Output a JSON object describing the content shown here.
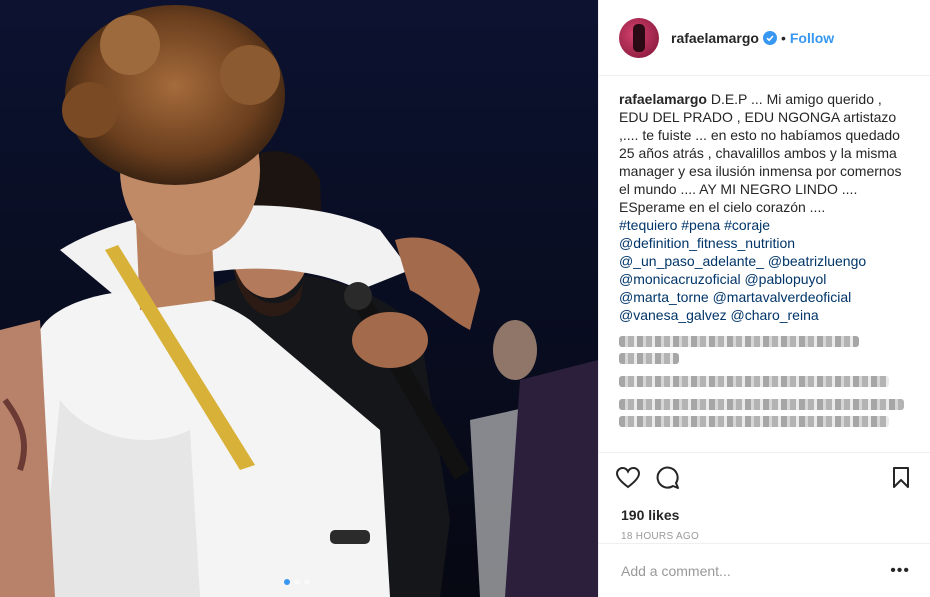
{
  "post": {
    "username": "rafaelamargo",
    "follow_label": "Follow",
    "separator": "•",
    "caption_user": "rafaelamargo",
    "caption_text": "D.E.P ... Mi amigo querido , EDU DEL PRADO , EDU NGONGA artistazo ,.... te fuiste ... en esto no habíamos quedado 25 años atrás , chavalillos ambos y la misma manager y esa ilusión inmensa por comernos el mundo .... AY MI NEGRO LINDO .... ESperame en el cielo corazón ....",
    "links": [
      "#tequiero #pena #coraje",
      "@definition_fitness_nutrition",
      "@_un_paso_adelante_ @beatrizluengo",
      "@monicacruzoficial @pablopuyol",
      "@marta_torne @martavalverdeoficial",
      "@vanesa_galvez @charo_reina"
    ],
    "likes": "190 likes",
    "time": "18 HOURS AGO",
    "comment_placeholder": "Add a comment...",
    "more_label": "•••"
  },
  "colors": {
    "accent": "#3897f0",
    "link": "#003569",
    "text": "#262626",
    "muted": "#999999"
  },
  "icons": [
    "verified-badge-icon",
    "heart-icon",
    "comment-icon",
    "bookmark-icon",
    "more-options-icon"
  ]
}
